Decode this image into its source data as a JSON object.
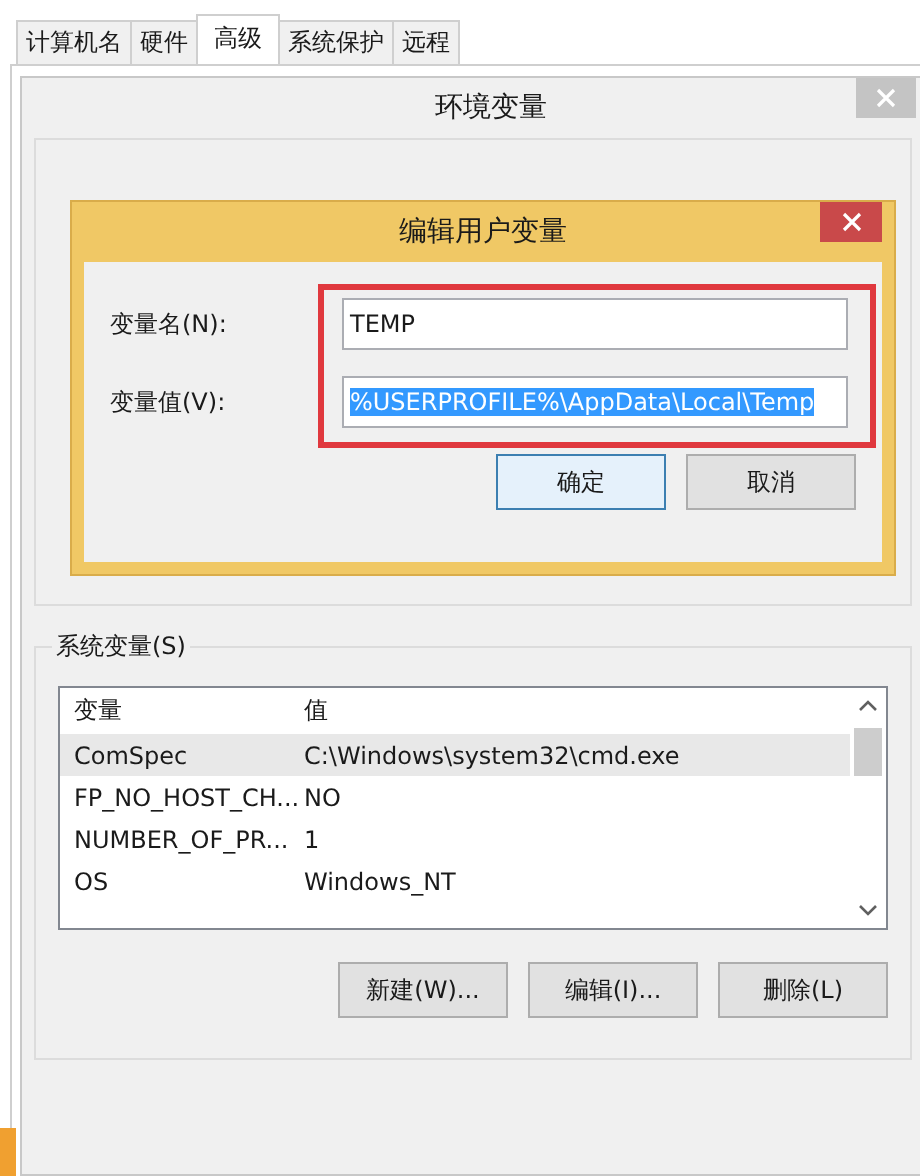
{
  "tabs": [
    {
      "label": "计算机名",
      "selected": false
    },
    {
      "label": "硬件",
      "selected": false
    },
    {
      "label": "高级",
      "selected": true
    },
    {
      "label": "系统保护",
      "selected": false
    },
    {
      "label": "远程",
      "selected": false
    }
  ],
  "env_dialog": {
    "title": "环境变量"
  },
  "edit_dialog": {
    "title": "编辑用户变量",
    "fields": [
      {
        "label": "变量名(N):",
        "value": "TEMP",
        "selected": false
      },
      {
        "label": "变量值(V):",
        "value": "%USERPROFILE%\\AppData\\Local\\Temp",
        "selected": true
      }
    ],
    "buttons": [
      {
        "label": "确定",
        "default": true
      },
      {
        "label": "取消",
        "default": false
      }
    ]
  },
  "system_variables": {
    "label": "系统变量(S)",
    "columns": [
      "变量",
      "值"
    ],
    "rows": [
      {
        "name": "ComSpec",
        "value": "C:\\Windows\\system32\\cmd.exe",
        "selected": true
      },
      {
        "name": "FP_NO_HOST_CH...",
        "value": "NO",
        "selected": false
      },
      {
        "name": "NUMBER_OF_PR...",
        "value": "1",
        "selected": false
      },
      {
        "name": "OS",
        "value": "Windows_NT",
        "selected": false
      }
    ],
    "buttons": [
      "新建(W)...",
      "编辑(I)...",
      "删除(L)"
    ]
  }
}
